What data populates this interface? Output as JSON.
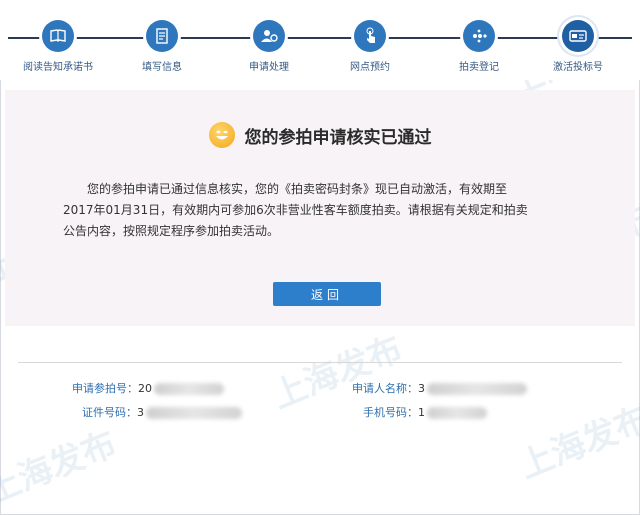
{
  "steps": [
    {
      "label": "阅读告知承诺书",
      "icon": "book-icon"
    },
    {
      "label": "填写信息",
      "icon": "form-icon"
    },
    {
      "label": "申请处理",
      "icon": "processing-icon"
    },
    {
      "label": "网点预约",
      "icon": "tap-icon"
    },
    {
      "label": "拍卖登记",
      "icon": "dots-icon"
    },
    {
      "label": "激活投标号",
      "icon": "card-icon"
    }
  ],
  "result": {
    "title": "您的参拍申请核实已通过",
    "line1": "您的参拍申请已通过信息核实，您的《拍卖密码封条》现已自动激活，有效期至",
    "line2": "2017年01月31日，有效期内可参加6次非营业性客车额度拍卖。请根据有关规定和拍卖",
    "line3": "公告内容，按照规定程序参加拍卖活动。",
    "back_label": "返回"
  },
  "info": {
    "application_no_label": "申请参拍号：",
    "application_no_value": "20",
    "applicant_name_label": "申请人名称：",
    "applicant_name_value": "3",
    "id_no_label": "证件号码：",
    "id_no_value": "3",
    "phone_label": "手机号码：",
    "phone_value": "1"
  },
  "watermark": {
    "text": "上海发布"
  },
  "colors": {
    "primary": "#2f77bd",
    "button": "#2e7fcb",
    "label": "#2f6fae",
    "card_bg": "#f7f3f6"
  }
}
